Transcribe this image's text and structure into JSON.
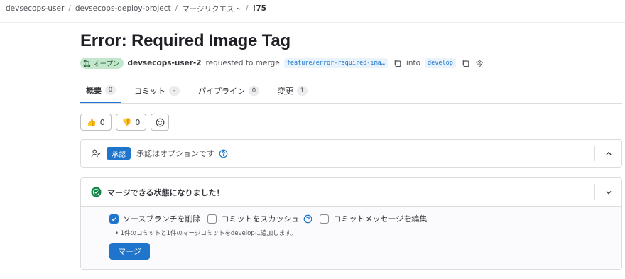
{
  "breadcrumb": {
    "items": [
      "devsecops-user",
      "devsecops-deploy-project",
      "マージリクエスト",
      "!75"
    ]
  },
  "mr": {
    "title": "Error: Required Image Tag",
    "status": "オープン",
    "author": "devsecops-user-2",
    "requested_text": "requested to merge",
    "source_branch": "feature/error-required-ima…",
    "into_text": "into",
    "target_branch": "develop",
    "time": "今"
  },
  "tabs": [
    {
      "label": "概要",
      "count": "0"
    },
    {
      "label": "コミット",
      "count": "-"
    },
    {
      "label": "パイプライン",
      "count": "0"
    },
    {
      "label": "変更",
      "count": "1"
    }
  ],
  "reactions": {
    "thumbsup": "0",
    "thumbsdown": "0"
  },
  "approval": {
    "button": "承認",
    "text": "承認はオプションです"
  },
  "merge": {
    "title": "マージできる状態になりました！",
    "options": [
      {
        "label": "ソースブランチを削除",
        "checked": true
      },
      {
        "label": "コミットをスカッシュ",
        "checked": false
      },
      {
        "label": "コミットメッセージを編集",
        "checked": false
      }
    ],
    "note": "• 1件のコミットと1件のマージコミットをdevelopに追加します。",
    "button": "マージ"
  },
  "colors": {
    "accent": "#1f75cb",
    "success": "#108548",
    "badge_bg": "#c3e6cd"
  },
  "icons": [
    "merge-request-icon",
    "copy-icon",
    "help-icon",
    "chevron-up-icon",
    "chevron-down-icon",
    "check-circle-icon",
    "smiley-icon",
    "approval-user-icon"
  ]
}
